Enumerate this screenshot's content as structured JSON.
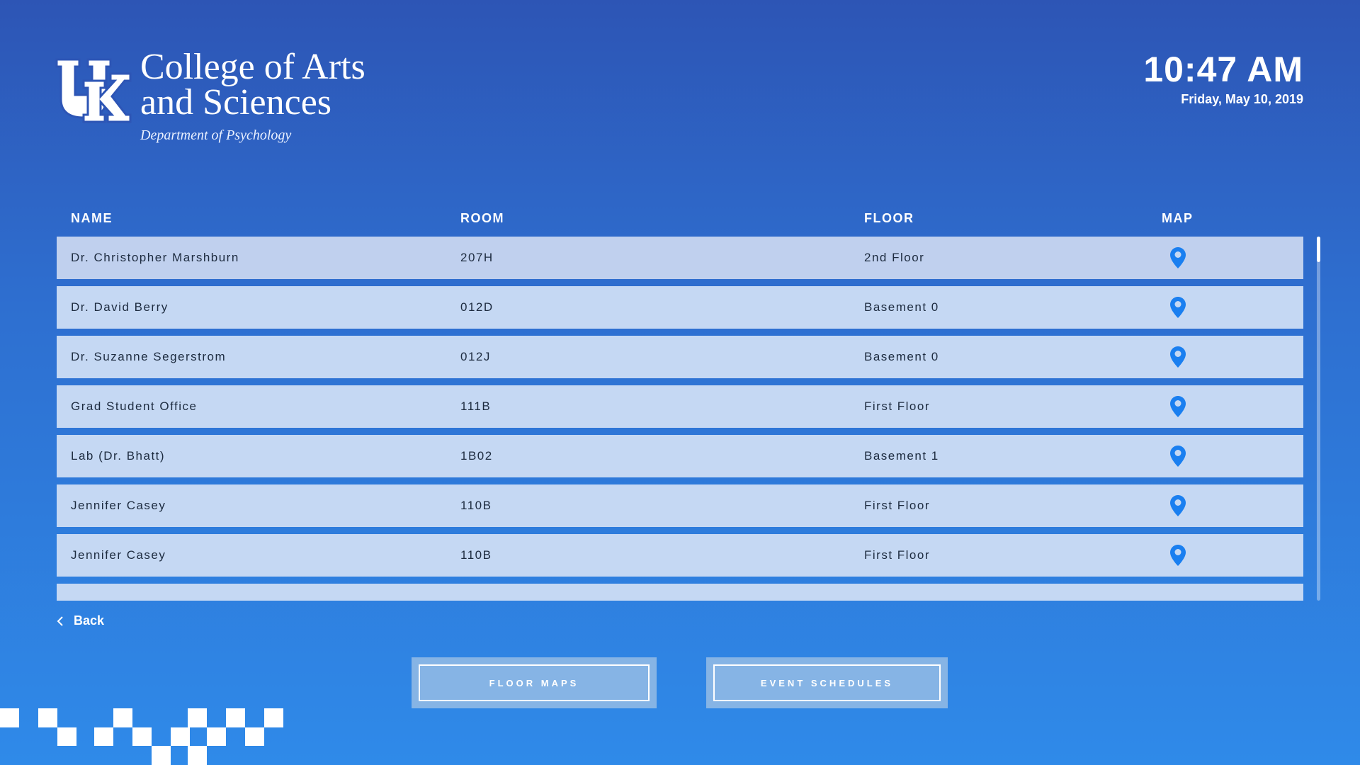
{
  "header": {
    "title_line1": "College of Arts",
    "title_line2": "and Sciences",
    "subtitle": "Department of Psychology",
    "logo_icon": "uk-logo-icon"
  },
  "clock": {
    "time": "10:47 AM",
    "date": "Friday, May 10, 2019"
  },
  "table": {
    "columns": [
      "NAME",
      "ROOM",
      "FLOOR",
      "MAP"
    ],
    "rows": [
      {
        "name": "Dr. Christopher Marshburn",
        "room": "207H",
        "floor": "2nd Floor",
        "map_icon": "map-pin-icon"
      },
      {
        "name": "Dr. David Berry",
        "room": "012D",
        "floor": "Basement 0",
        "map_icon": "map-pin-icon"
      },
      {
        "name": "Dr. Suzanne Segerstrom",
        "room": "012J",
        "floor": "Basement 0",
        "map_icon": "map-pin-icon"
      },
      {
        "name": "Grad Student Office",
        "room": "111B",
        "floor": "First Floor",
        "map_icon": "map-pin-icon"
      },
      {
        "name": "Lab (Dr. Bhatt)",
        "room": "1B02",
        "floor": "Basement 1",
        "map_icon": "map-pin-icon"
      },
      {
        "name": "Jennifer Casey",
        "room": "110B",
        "floor": "First Floor",
        "map_icon": "map-pin-icon"
      },
      {
        "name": "Jennifer Casey",
        "room": "110B",
        "floor": "First Floor",
        "map_icon": "map-pin-icon"
      }
    ]
  },
  "nav": {
    "back_label": "Back",
    "floor_maps_label": "FLOOR MAPS",
    "event_schedules_label": "EVENT SCHEDULES"
  },
  "colors": {
    "accent_pin": "#1a7ff0",
    "row_bg": "#c5d8f3",
    "background_top": "#2d55b5",
    "background_bottom": "#2f8ae9"
  }
}
